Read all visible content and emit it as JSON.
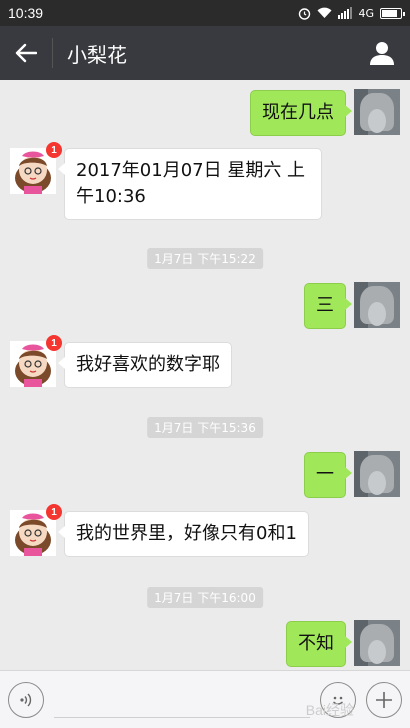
{
  "status": {
    "time": "10:39",
    "network": "4G"
  },
  "header": {
    "title": "小梨花",
    "back_icon": "arrow-left-icon",
    "profile_icon": "person-icon"
  },
  "messages": [
    {
      "side": "right",
      "text": "现在几点"
    },
    {
      "side": "left",
      "text": "2017年01月07日 星期六 上午10:36",
      "badge": "1"
    },
    {
      "type": "time",
      "text": "1月7日 下午15:22"
    },
    {
      "side": "right",
      "text": "三"
    },
    {
      "side": "left",
      "text": "我好喜欢的数字耶",
      "badge": "1"
    },
    {
      "type": "time",
      "text": "1月7日 下午15:36"
    },
    {
      "side": "right",
      "text": "一"
    },
    {
      "side": "left",
      "text": "我的世界里，好像只有0和1",
      "badge": "1"
    },
    {
      "type": "time",
      "text": "1月7日 下午16:00"
    },
    {
      "side": "right",
      "text": "不知"
    }
  ],
  "input": {
    "voice_icon": "voice-icon",
    "emoji_icon": "emoji-icon",
    "more_icon": "plus-icon"
  },
  "watermark": "Bai经验",
  "colors": {
    "title_bar": "#393a3f",
    "bubble_green": "#a0e75a",
    "badge": "#f43530"
  }
}
